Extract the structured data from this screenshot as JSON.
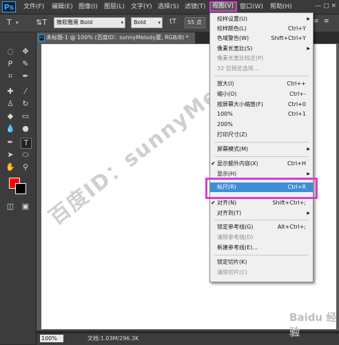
{
  "menubar": {
    "logo": "Ps",
    "items": [
      "文件(F)",
      "编辑(E)",
      "图像(I)",
      "图层(L)",
      "文字(Y)",
      "选择(S)",
      "滤镜(T)",
      "视图(V)",
      "窗口(W)",
      "帮助(H)"
    ],
    "window_controls": "—  □  ✕"
  },
  "options": {
    "font_family": "微软雅黑 Bold",
    "font_style": "Bold",
    "font_size": "55 点"
  },
  "document": {
    "tab_title": "未标题-1 @ 100% (百度ID：sunnyMelody夏, RGB/8) *",
    "watermark": "百度ID：sunnyMelody夏",
    "zoom": "100%",
    "info": "文档:1.03M/296.3K",
    "baidu_mark": "Baidu 经验"
  },
  "colors": {
    "foreground": "#ff0000",
    "background": "#000000",
    "highlight": "#3e8fd8",
    "annotation": "#d93bd4"
  },
  "view_menu": {
    "items": [
      {
        "label": "校样设置(U)",
        "shortcut": "",
        "submenu": true,
        "disabled": false
      },
      {
        "label": "校样颜色(L)",
        "shortcut": "Ctrl+Y",
        "submenu": false,
        "disabled": false
      },
      {
        "label": "色域警告(W)",
        "shortcut": "Shift+Ctrl+Y",
        "submenu": false,
        "disabled": false
      },
      {
        "label": "像素长宽比(S)",
        "shortcut": "",
        "submenu": true,
        "disabled": false
      },
      {
        "label": "像素长宽比校正(P)",
        "shortcut": "",
        "submenu": false,
        "disabled": true
      },
      {
        "label": "32 位预览选项...",
        "shortcut": "",
        "submenu": false,
        "disabled": true
      },
      {
        "label": "放大(I)",
        "shortcut": "Ctrl++",
        "submenu": false,
        "disabled": false
      },
      {
        "label": "缩小(O)",
        "shortcut": "Ctrl+-",
        "submenu": false,
        "disabled": false
      },
      {
        "label": "按屏幕大小缩放(F)",
        "shortcut": "Ctrl+0",
        "submenu": false,
        "disabled": false
      },
      {
        "label": "100%",
        "shortcut": "Ctrl+1",
        "submenu": false,
        "disabled": false
      },
      {
        "label": "200%",
        "shortcut": "",
        "submenu": false,
        "disabled": false
      },
      {
        "label": "打印尺寸(Z)",
        "shortcut": "",
        "submenu": false,
        "disabled": false
      },
      {
        "label": "屏幕模式(M)",
        "shortcut": "",
        "submenu": true,
        "disabled": false
      },
      {
        "label": "显示额外内容(X)",
        "shortcut": "Ctrl+H",
        "submenu": false,
        "disabled": false,
        "checked": true
      },
      {
        "label": "显示(H)",
        "shortcut": "",
        "submenu": true,
        "disabled": false
      },
      {
        "label": "标尺(R)",
        "shortcut": "Ctrl+R",
        "submenu": false,
        "disabled": false,
        "highlighted": true
      },
      {
        "label": "对齐(N)",
        "shortcut": "Shift+Ctrl+;",
        "submenu": false,
        "disabled": false,
        "checked": true
      },
      {
        "label": "对齐到(T)",
        "shortcut": "",
        "submenu": true,
        "disabled": false
      },
      {
        "label": "锁定参考线(G)",
        "shortcut": "Alt+Ctrl+;",
        "submenu": false,
        "disabled": false
      },
      {
        "label": "清除参考线(D)",
        "shortcut": "",
        "submenu": false,
        "disabled": true
      },
      {
        "label": "新建参考线(E)...",
        "shortcut": "",
        "submenu": false,
        "disabled": false
      },
      {
        "label": "锁定切片(K)",
        "shortcut": "",
        "submenu": false,
        "disabled": false
      },
      {
        "label": "清除切片(C)",
        "shortcut": "",
        "submenu": false,
        "disabled": true
      }
    ]
  }
}
